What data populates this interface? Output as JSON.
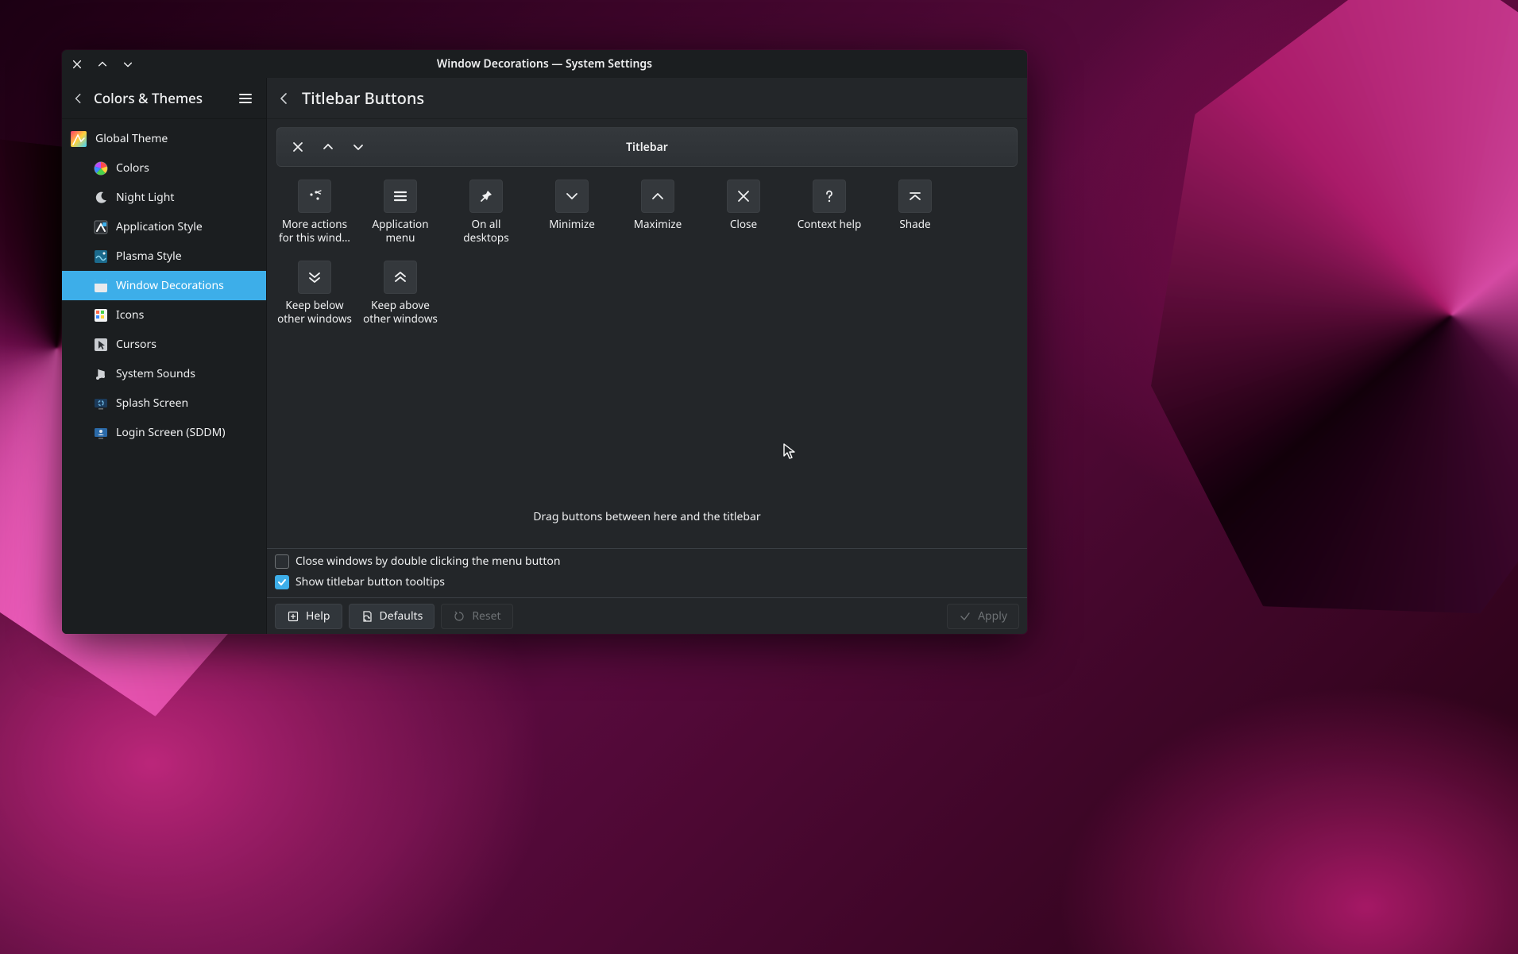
{
  "window": {
    "title": "Window Decorations — System Settings"
  },
  "sidebar": {
    "crumb": "Colors & Themes",
    "items": [
      {
        "id": "global-theme",
        "label": "Global Theme",
        "child": false,
        "selected": false,
        "icon": "global-theme-icon"
      },
      {
        "id": "colors",
        "label": "Colors",
        "child": true,
        "selected": false,
        "icon": "colors-icon"
      },
      {
        "id": "night-light",
        "label": "Night Light",
        "child": true,
        "selected": false,
        "icon": "night-light-icon"
      },
      {
        "id": "application-style",
        "label": "Application Style",
        "child": true,
        "selected": false,
        "icon": "application-style-icon"
      },
      {
        "id": "plasma-style",
        "label": "Plasma Style",
        "child": true,
        "selected": false,
        "icon": "plasma-style-icon"
      },
      {
        "id": "window-decorations",
        "label": "Window Decorations",
        "child": true,
        "selected": true,
        "icon": "window-decorations-icon"
      },
      {
        "id": "icons",
        "label": "Icons",
        "child": true,
        "selected": false,
        "icon": "icons-icon"
      },
      {
        "id": "cursors",
        "label": "Cursors",
        "child": true,
        "selected": false,
        "icon": "cursors-icon"
      },
      {
        "id": "system-sounds",
        "label": "System Sounds",
        "child": true,
        "selected": false,
        "icon": "system-sounds-icon"
      },
      {
        "id": "splash-screen",
        "label": "Splash Screen",
        "child": true,
        "selected": false,
        "icon": "splash-screen-icon"
      },
      {
        "id": "login-screen",
        "label": "Login Screen (SDDM)",
        "child": true,
        "selected": false,
        "icon": "login-screen-icon"
      }
    ]
  },
  "page": {
    "title": "Titlebar Buttons",
    "titlebar_preview_label": "Titlebar",
    "titlebar_preview_buttons": [
      "close",
      "keep-above",
      "keep-below"
    ],
    "hint": "Drag buttons between here and the titlebar",
    "palette": [
      {
        "id": "more-actions",
        "label": "More actions for this wind…",
        "icon": "more-actions-icon"
      },
      {
        "id": "app-menu",
        "label": "Application menu",
        "icon": "hamburger-icon"
      },
      {
        "id": "all-desktops",
        "label": "On all desktops",
        "icon": "pin-icon"
      },
      {
        "id": "minimize",
        "label": "Minimize",
        "icon": "chevron-down-icon"
      },
      {
        "id": "maximize",
        "label": "Maximize",
        "icon": "chevron-up-icon"
      },
      {
        "id": "close",
        "label": "Close",
        "icon": "close-icon"
      },
      {
        "id": "context-help",
        "label": "Context help",
        "icon": "question-icon"
      },
      {
        "id": "shade",
        "label": "Shade",
        "icon": "shade-icon"
      },
      {
        "id": "keep-below",
        "label": "Keep below other windows",
        "icon": "double-chevron-down-icon"
      },
      {
        "id": "keep-above",
        "label": "Keep above other windows",
        "icon": "double-chevron-up-icon"
      }
    ],
    "options": [
      {
        "id": "close-dbl-click",
        "label": "Close windows by double clicking the menu button",
        "checked": false
      },
      {
        "id": "show-tooltips",
        "label": "Show titlebar button tooltips",
        "checked": true
      }
    ]
  },
  "footer": {
    "help": "Help",
    "defaults": "Defaults",
    "reset": "Reset",
    "apply": "Apply"
  }
}
